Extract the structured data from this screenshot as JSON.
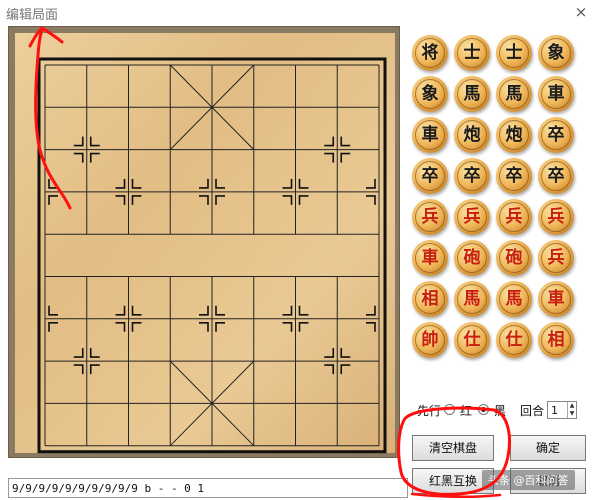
{
  "window": {
    "title": "编辑局面",
    "close_label": "×"
  },
  "board": {
    "frame_color": "#8a7a62",
    "wood_color": "#e6c48e",
    "line_color": "#222222"
  },
  "palette": {
    "pieces": [
      {
        "char": "将",
        "color": "black"
      },
      {
        "char": "士",
        "color": "black"
      },
      {
        "char": "士",
        "color": "black"
      },
      {
        "char": "象",
        "color": "black"
      },
      {
        "char": "象",
        "color": "black"
      },
      {
        "char": "馬",
        "color": "black"
      },
      {
        "char": "馬",
        "color": "black"
      },
      {
        "char": "車",
        "color": "black"
      },
      {
        "char": "車",
        "color": "black"
      },
      {
        "char": "炮",
        "color": "black"
      },
      {
        "char": "炮",
        "color": "black"
      },
      {
        "char": "卒",
        "color": "black"
      },
      {
        "char": "卒",
        "color": "black"
      },
      {
        "char": "卒",
        "color": "black"
      },
      {
        "char": "卒",
        "color": "black"
      },
      {
        "char": "卒",
        "color": "black"
      },
      {
        "char": "兵",
        "color": "red"
      },
      {
        "char": "兵",
        "color": "red"
      },
      {
        "char": "兵",
        "color": "red"
      },
      {
        "char": "兵",
        "color": "red"
      },
      {
        "char": "車",
        "color": "red"
      },
      {
        "char": "砲",
        "color": "red"
      },
      {
        "char": "砲",
        "color": "red"
      },
      {
        "char": "兵",
        "color": "red"
      },
      {
        "char": "相",
        "color": "red"
      },
      {
        "char": "馬",
        "color": "red"
      },
      {
        "char": "馬",
        "color": "red"
      },
      {
        "char": "車",
        "color": "red"
      },
      {
        "char": "帥",
        "color": "red"
      },
      {
        "char": "仕",
        "color": "red"
      },
      {
        "char": "仕",
        "color": "red"
      },
      {
        "char": "相",
        "color": "red"
      }
    ]
  },
  "first_move": {
    "label": "先行",
    "red_label": "红",
    "black_label": "黑",
    "selected": "black"
  },
  "round": {
    "label": "回合",
    "value": "1",
    "up_icon": "▲",
    "down_icon": "▼"
  },
  "buttons": {
    "clear_board": "清空棋盘",
    "confirm": "确定",
    "swap_colors": "红黑互换",
    "cancel": "取消"
  },
  "fen": {
    "value": "9/9/9/9/9/9/9/9/9/9 b - - 0 1"
  },
  "watermark": "头条 @百科问答",
  "annotation_color": "#ff1010"
}
